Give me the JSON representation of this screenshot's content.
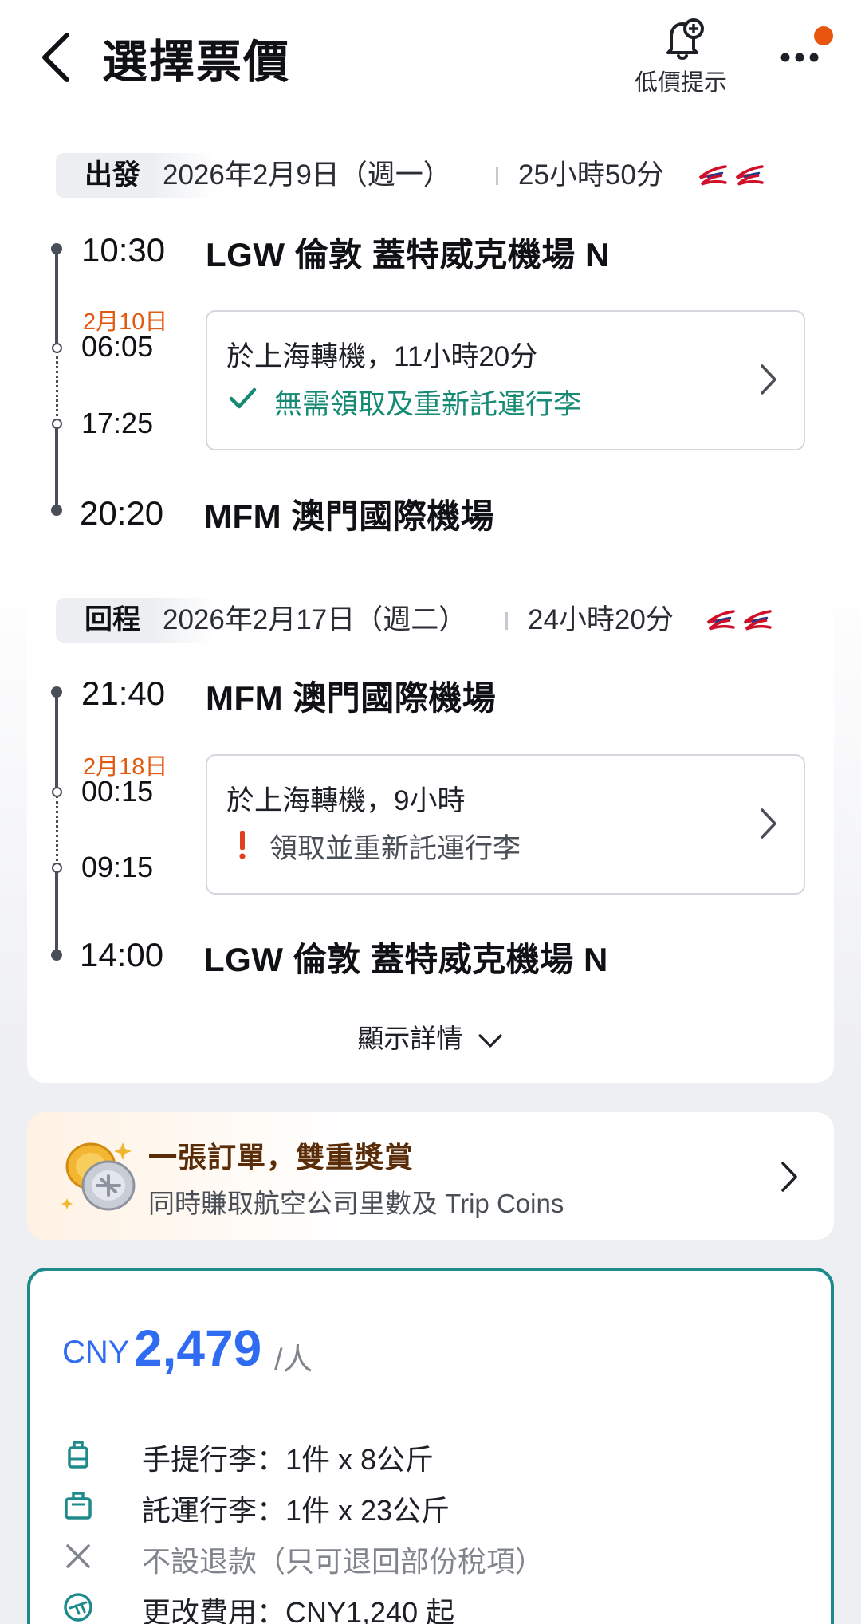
{
  "header": {
    "title": "選擇票價",
    "price_alert_label": "低價提示"
  },
  "outbound": {
    "tag": "出發",
    "date": "2026年2月9日（週一）",
    "duration": "25小時50分",
    "depart_time": "10:30",
    "depart_airport": "LGW 倫敦 蓋特威克機場 N",
    "next_day_label": "2月10日",
    "arrive_transfer_time": "06:05",
    "leave_transfer_time": "17:25",
    "transfer_title": "於上海轉機，11小時20分",
    "transfer_note": "無需領取及重新託運行李",
    "arrive_time": "20:20",
    "arrive_airport": "MFM 澳門國際機場"
  },
  "return": {
    "tag": "回程",
    "date": "2026年2月17日（週二）",
    "duration": "24小時20分",
    "depart_time": "21:40",
    "depart_airport": "MFM 澳門國際機場",
    "next_day_label": "2月18日",
    "arrive_transfer_time": "00:15",
    "leave_transfer_time": "09:15",
    "transfer_title": "於上海轉機，9小時",
    "transfer_note": "領取並重新託運行李",
    "arrive_time": "14:00",
    "arrive_airport": "LGW 倫敦 蓋特威克機場 N"
  },
  "show_details_label": "顯示詳情",
  "rewards": {
    "title": "一張訂單，雙重獎賞",
    "subtitle": "同時賺取航空公司里數及 Trip Coins"
  },
  "fare": {
    "currency": "CNY",
    "amount": "2,479",
    "per": "/人",
    "features": [
      {
        "icon": "carry-on-bag-icon",
        "text": "手提行李：1件 x 8公斤"
      },
      {
        "icon": "checked-bag-icon",
        "text": "託運行李：1件 x 23公斤"
      },
      {
        "icon": "no-refund-icon",
        "text": "不設退款（只可退回部份稅項）"
      },
      {
        "icon": "change-fee-icon",
        "text": "更改費用：CNY1,240 起"
      }
    ]
  },
  "colors": {
    "accent_price": "#2f6cf2",
    "selected_border": "#1f8a8c",
    "next_day": "#e05a12",
    "check_green": "#178a74",
    "warning_red": "#e0401e",
    "badge_orange": "#e8550f",
    "reward_title": "#5a2c08"
  }
}
